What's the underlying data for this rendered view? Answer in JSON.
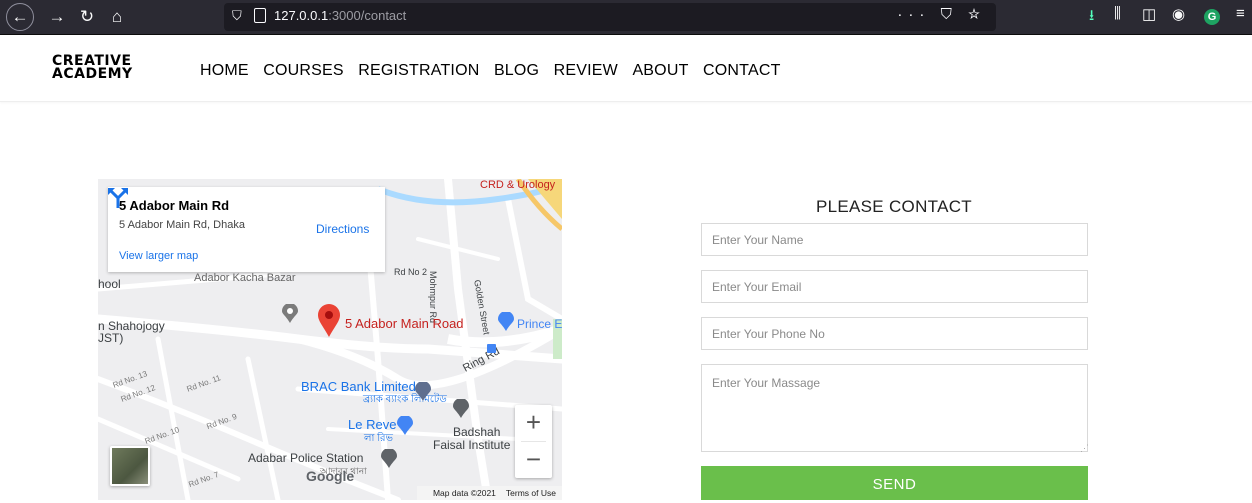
{
  "browser": {
    "back_icon": "arrow-left-icon",
    "forward_icon": "arrow-right-icon",
    "url_host": "127.0.0.1",
    "url_rest": ":3000/contact",
    "url_actions": "··· ⛉ ☆"
  },
  "site": {
    "logo_line1": "CREATIVE",
    "logo_line2": "ACADEMY",
    "nav": [
      "HOME",
      "COURSES",
      "REGISTRATION",
      "BLOG",
      "REVIEW",
      "ABOUT",
      "CONTACT"
    ]
  },
  "map": {
    "place_title": "5 Adabor Main Rd",
    "place_address": "5 Adabor Main Rd, Dhaka",
    "directions_label": "Directions",
    "view_larger": "View larger map",
    "pin_label": "5 Adabor Main Road",
    "labels": {
      "school": "hool",
      "shahojogy": "n Shahojogy",
      "ust": "JST)",
      "rd2": "Rd No 2",
      "mohmpur": "Mohmpur Rd",
      "golden": "Golden Street",
      "ring": "Ring Rd",
      "prince": "Prince E",
      "brac": "BRAC Bank Limited",
      "brac_bn": "ব্র্যাক ব্যাংক লিমিটেড",
      "lereve": "Le Reve",
      "lereve_bn": "লা রিভ",
      "badshah1": "Badshah",
      "badshah2": "Faisal Institute",
      "police": "Adabar Police Station",
      "police_bn": "আদাবর থানা",
      "bazar": "Adabor Kacha Bazar",
      "crd": "CRD & Urology",
      "rd13": "Rd No. 13",
      "rd12": "Rd No. 12",
      "rd11": "Rd No. 11",
      "rd10": "Rd No. 10",
      "rd9": "Rd No. 9",
      "rd7": "Rd No. 7"
    },
    "google": "Google",
    "footer_data": "Map data ©2021",
    "footer_terms": "Terms of Use",
    "zoom_in": "+",
    "zoom_out": "−"
  },
  "form": {
    "title": "PLEASE CONTACT",
    "name_placeholder": "Enter Your Name",
    "email_placeholder": "Enter Your Email",
    "phone_placeholder": "Enter Your Phone No",
    "message_placeholder": "Enter Your Massage",
    "send_label": "SEND"
  },
  "colors": {
    "send_button": "#6abf4b",
    "map_pin": "#ea4335",
    "link_blue": "#1a73e8"
  }
}
